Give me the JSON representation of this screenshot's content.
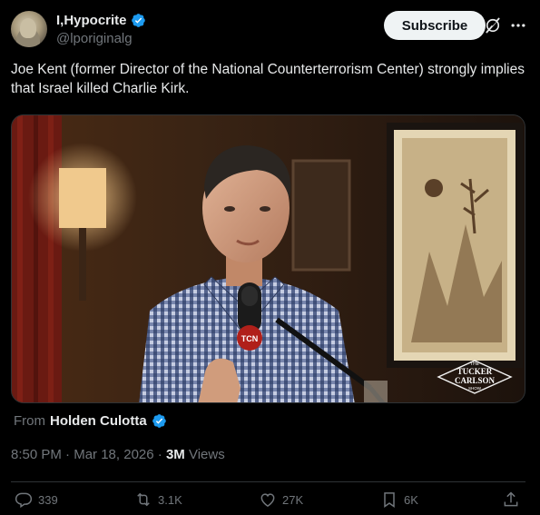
{
  "author": {
    "display_name": "I,Hypocrite",
    "handle": "@lporiginalg",
    "verified": true
  },
  "subscribe_label": "Subscribe",
  "tweet_text": "Joe Kent (former Director of the National Counterterrorism Center) strongly implies that Israel killed Charlie Kirk.",
  "media": {
    "mic_logo": "TCN",
    "watermark": [
      "THE",
      "TUCKER",
      "CARLSON",
      "SHOW"
    ]
  },
  "source": {
    "prefix": "From",
    "name": "Holden Culotta",
    "verified": true
  },
  "meta": {
    "time": "8:50 PM",
    "separator": "·",
    "date": "Mar 18, 2026",
    "views_count": "3M",
    "views_label": "Views"
  },
  "actions": {
    "replies": "339",
    "reposts": "3.1K",
    "likes": "27K",
    "bookmarks": "6K"
  },
  "colors": {
    "background": "#000000",
    "text_primary": "#e7e9ea",
    "text_secondary": "#71767b",
    "verified_blue": "#1d9bf0",
    "divider": "#2f3336"
  },
  "icons": [
    "verified-badge-icon",
    "grok-icon",
    "more-icon",
    "reply-icon",
    "repost-icon",
    "like-icon",
    "bookmark-icon",
    "share-icon"
  ]
}
